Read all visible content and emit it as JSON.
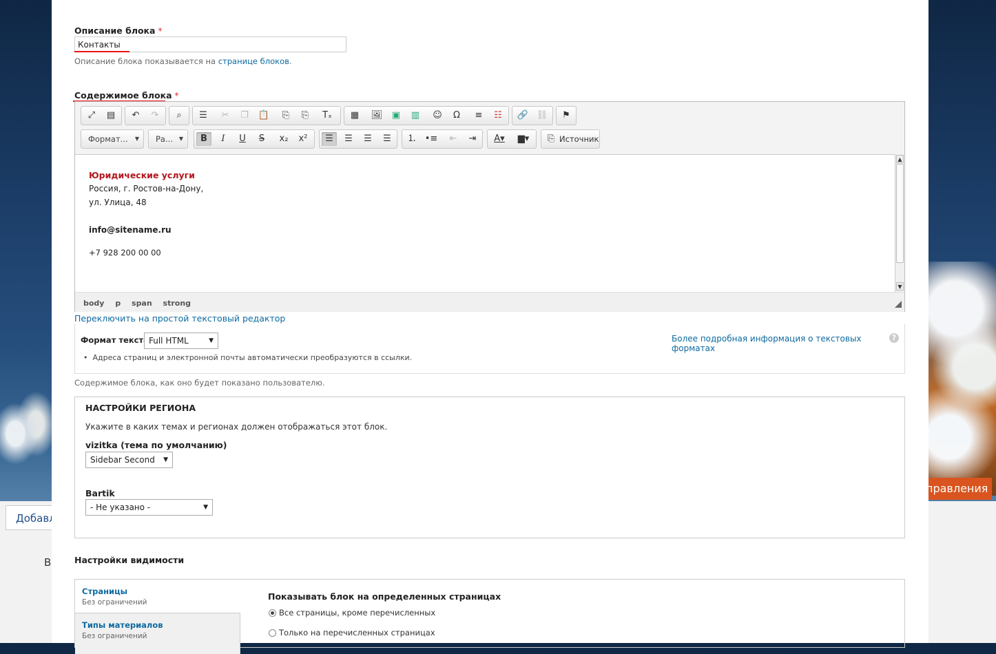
{
  "background": {
    "orange_button_text": "правления",
    "left_tab_text": "Добавл",
    "left_letter": "В"
  },
  "block_description": {
    "label": "Описание блока",
    "required_mark": "*",
    "value": "Контакты",
    "help_prefix": "Описание блока показывается на",
    "help_link": "странице блоков",
    "help_suffix": "."
  },
  "block_content": {
    "label": "Содержимое блока",
    "required_mark": "*",
    "toolbar": {
      "row1": [
        "maximize-icon",
        "show-blocks-icon",
        "undo-icon",
        "redo-icon",
        "find-icon",
        "select-all-icon",
        "cut-icon",
        "copy-icon",
        "paste-icon",
        "paste-text-icon",
        "paste-word-icon",
        "remove-format-icon",
        "table-icon",
        "image-icon",
        "iframe-icon",
        "flash-icon",
        "smiley-icon",
        "special-char-icon",
        "horizontal-rule-icon",
        "page-break-icon",
        "link-icon",
        "unlink-icon",
        "anchor-icon"
      ],
      "format_combo": "Формат...",
      "size_combo": "Ра...",
      "bold": "B",
      "italic": "I",
      "underline": "U",
      "strike": "S",
      "subscript": "x₂",
      "superscript": "x²",
      "source_label": "Источник"
    },
    "content": {
      "company": "Юридические услуги",
      "address1": "Россия, г. Ростов-на-Дону,",
      "address2": "ул. Улица, 48",
      "email": "info@sitename.ru",
      "phone": "+7 928 200 00 00"
    },
    "status_path": [
      "body",
      "p",
      "span",
      "strong"
    ],
    "switch_link": "Переключить на простой текстовый редактор",
    "text_format": {
      "label": "Формат текста",
      "selected": "Full HTML",
      "more_info_link": "Более подробная информация о текстовых форматах",
      "tip": "Адреса страниц и электронной почты автоматически преобразуются в ссылки."
    },
    "help": "Содержимое блока, как оно будет показано пользователю."
  },
  "region_settings": {
    "title": "НАСТРОЙКИ РЕГИОНА",
    "desc": "Укажите в каких темах и регионах должен отображаться этот блок.",
    "theme1_label": "vizitka (тема по умолчанию)",
    "theme1_selected": "Sidebar Second",
    "theme2_label": "Bartik",
    "theme2_selected": "- Не указано -"
  },
  "visibility": {
    "title": "Настройки видимости",
    "tabs": [
      {
        "title": "Страницы",
        "summary": "Без ограничений"
      },
      {
        "title": "Типы материалов",
        "summary": "Без ограничений"
      }
    ],
    "pages_title": "Показывать блок на определенных страницах",
    "option1": "Все страницы, кроме перечисленных",
    "option2": "Только на перечисленных страницах"
  },
  "colors": {
    "accent_red": "#e11",
    "company_red": "#b3171e",
    "link_blue": "#0d6aa0"
  }
}
